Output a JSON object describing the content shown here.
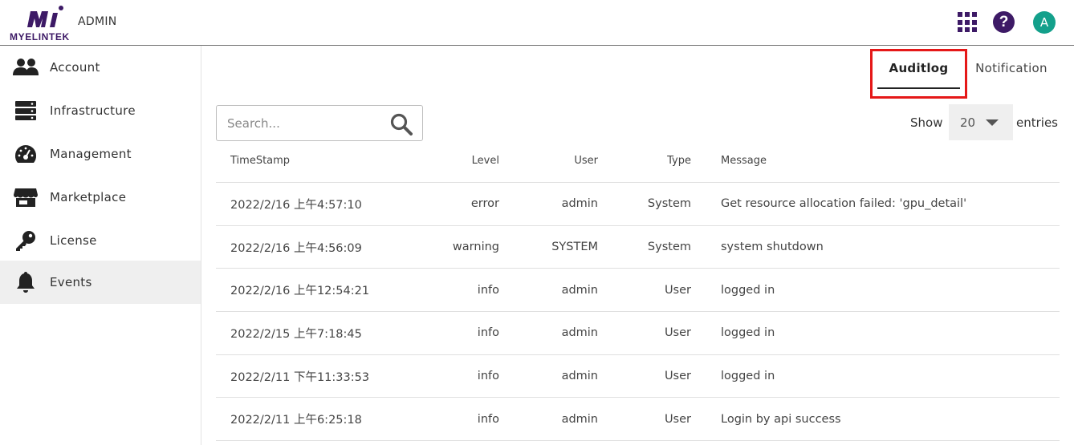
{
  "header": {
    "brand": "MYELINTEK",
    "role_label": "ADMIN",
    "avatar_letter": "A",
    "icons": [
      "apps-grid-icon",
      "help-icon",
      "user-avatar"
    ]
  },
  "sidebar": {
    "items": [
      {
        "label": "Account",
        "icon": "users-icon"
      },
      {
        "label": "Infrastructure",
        "icon": "server-icon"
      },
      {
        "label": "Management",
        "icon": "dashboard-gauge-icon"
      },
      {
        "label": "Marketplace",
        "icon": "store-icon"
      },
      {
        "label": "License",
        "icon": "key-icon"
      },
      {
        "label": "Events",
        "icon": "bell-icon",
        "active": true
      }
    ]
  },
  "tabs": [
    {
      "label": "Auditlog",
      "active": true
    },
    {
      "label": "Notification",
      "active": false
    }
  ],
  "search": {
    "placeholder": "Search..."
  },
  "pagination": {
    "show_label": "Show",
    "page_size": "20",
    "entries_label": "entries"
  },
  "table": {
    "columns": [
      "TimeStamp",
      "Level",
      "User",
      "Type",
      "Message"
    ],
    "rows": [
      {
        "timestamp": "2022/2/16 上午4:57:10",
        "level": "error",
        "user": "admin",
        "type": "System",
        "message": "Get resource allocation failed: 'gpu_detail'"
      },
      {
        "timestamp": "2022/2/16 上午4:56:09",
        "level": "warning",
        "user": "SYSTEM",
        "type": "System",
        "message": "system shutdown"
      },
      {
        "timestamp": "2022/2/16 上午12:54:21",
        "level": "info",
        "user": "admin",
        "type": "User",
        "message": "logged in"
      },
      {
        "timestamp": "2022/2/15 上午7:18:45",
        "level": "info",
        "user": "admin",
        "type": "User",
        "message": "logged in"
      },
      {
        "timestamp": "2022/2/11 下午11:33:53",
        "level": "info",
        "user": "admin",
        "type": "User",
        "message": "logged in"
      },
      {
        "timestamp": "2022/2/11 上午6:25:18",
        "level": "info",
        "user": "admin",
        "type": "User",
        "message": "Login by api success"
      }
    ]
  },
  "colors": {
    "brand_purple": "#3d1a66",
    "avatar_teal": "#13a08b",
    "highlight_red": "#e51818",
    "active_sidebar": "#efefef"
  }
}
